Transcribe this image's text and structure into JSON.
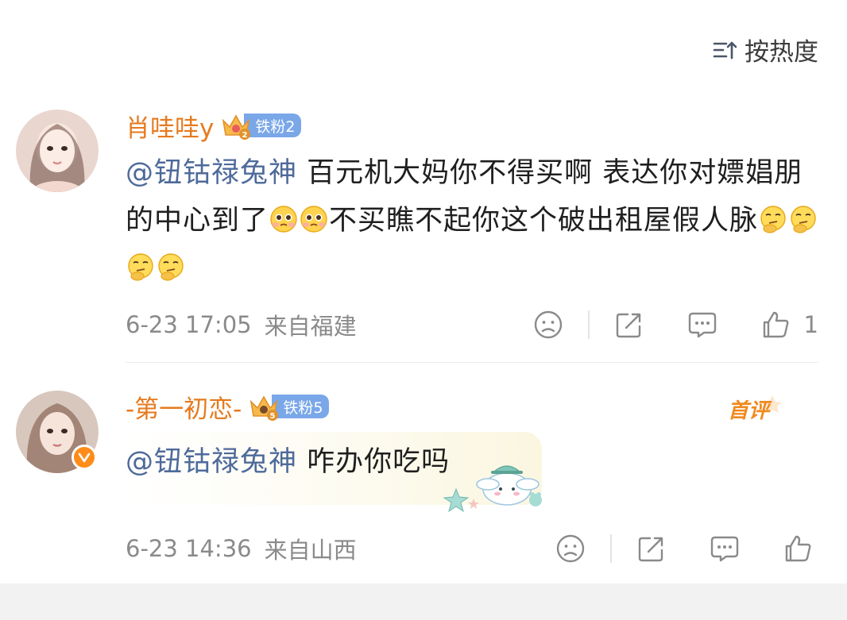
{
  "sort": {
    "label": "按热度",
    "icon": "sort-icon"
  },
  "comments": [
    {
      "username": "肖哇哇y",
      "fan_level": "铁粉2",
      "fan_level_number": 2,
      "mention": "@钮钴禄兔神",
      "text_part1": " 百元机大妈你不得买啊 表达你对嫖娼朋的中心到了",
      "emoji_a": "pleading-face",
      "text_part2": "不买瞧不起你这个破出租屋假人脉",
      "emoji_b": "thinking-face",
      "time": "6-23 17:05",
      "location": "来自福建",
      "like_count": "1",
      "icons": [
        "dislike-icon",
        "share-icon",
        "reply-icon",
        "like-icon"
      ]
    },
    {
      "username": "-第一初恋-",
      "fan_level": "铁粉5",
      "fan_level_number": 5,
      "verified": true,
      "first_comment_tag": "首评",
      "mention": "@钮钴禄兔神",
      "text": " 咋办你吃吗",
      "bubble_decoration": "cinnamoroll-sticker",
      "time": "6-23 14:36",
      "location": "来自山西",
      "like_count": "",
      "icons": [
        "dislike-icon",
        "share-icon",
        "reply-icon",
        "like-icon"
      ]
    }
  ],
  "colors": {
    "username": "#e67a1e",
    "mention": "#4e6a9a",
    "fan_badge": "#7aa7e8",
    "meta_text": "#8a8a8a",
    "verify": "#ff8c1a"
  }
}
